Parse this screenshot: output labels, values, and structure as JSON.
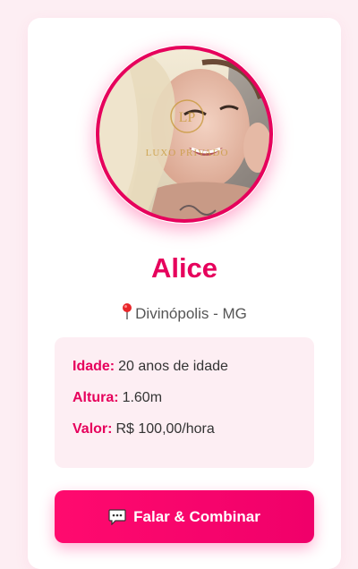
{
  "profile": {
    "name": "Alice",
    "location": "Divinópolis - MG",
    "watermark": "LUXO PRIVADO",
    "watermark_monogram": "LP"
  },
  "details": [
    {
      "label": "Idade:",
      "value": "20 anos de idade"
    },
    {
      "label": "Altura:",
      "value": "1.60m"
    },
    {
      "label": "Valor:",
      "value": "R$ 100,00/hora"
    }
  ],
  "cta": {
    "label": "Falar & Combinar",
    "icon": "speech-balloon-icon"
  },
  "colors": {
    "accent": "#e6005c",
    "button": "#ff0a6e",
    "page_background": "#fdeef3",
    "info_background": "#fdeef3"
  }
}
